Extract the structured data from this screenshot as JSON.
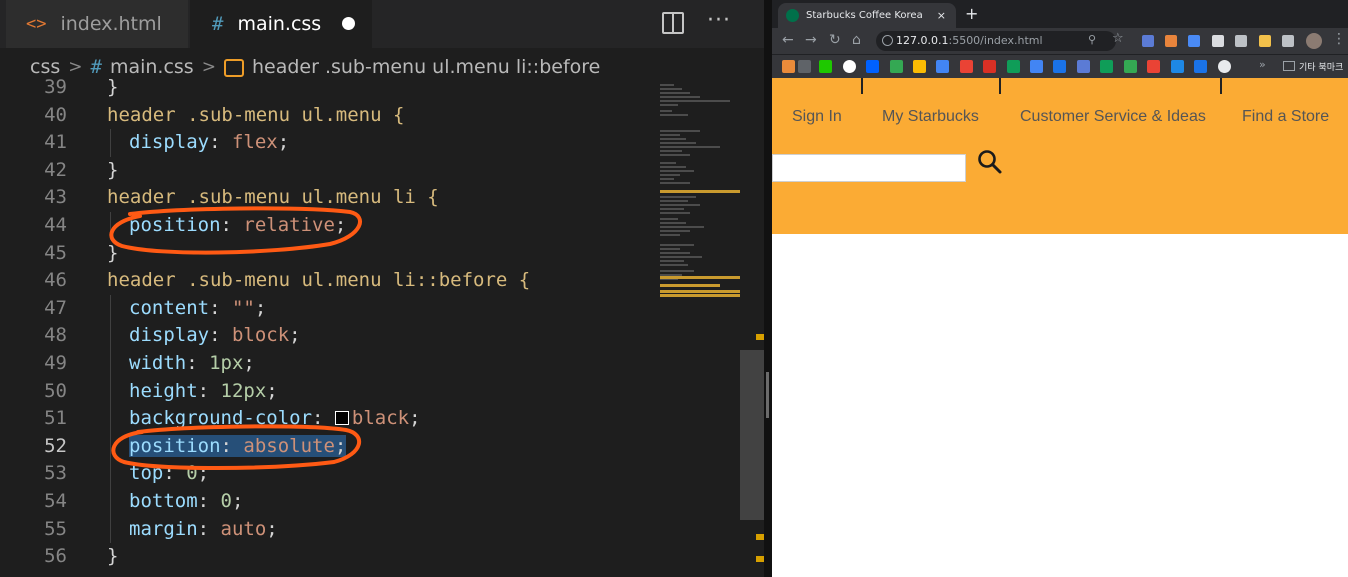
{
  "editor": {
    "tabs": [
      {
        "label": "index.html",
        "icon": "<>"
      },
      {
        "label": "main.css",
        "icon": "#"
      }
    ],
    "breadcrumb": {
      "folder": "css",
      "file": "main.css",
      "symbol": "header .sub-menu ul.menu li::before"
    },
    "lines": [
      {
        "n": "39",
        "text": "}"
      },
      {
        "n": "40",
        "text": "header .sub-menu ul.menu {"
      },
      {
        "n": "41",
        "prop": "display",
        "value": "flex"
      },
      {
        "n": "42",
        "text": "}"
      },
      {
        "n": "43",
        "text": "header .sub-menu ul.menu li {"
      },
      {
        "n": "44",
        "prop": "position",
        "value": "relative"
      },
      {
        "n": "45",
        "text": "}"
      },
      {
        "n": "46",
        "text": "header .sub-menu ul.menu li::before {"
      },
      {
        "n": "47",
        "prop": "content",
        "value": "\"\""
      },
      {
        "n": "48",
        "prop": "display",
        "value": "block"
      },
      {
        "n": "49",
        "prop": "width",
        "value": "1px"
      },
      {
        "n": "50",
        "prop": "height",
        "value": "12px"
      },
      {
        "n": "51",
        "prop": "background-color",
        "value": "black"
      },
      {
        "n": "52",
        "prop": "position",
        "value": "absolute"
      },
      {
        "n": "53",
        "prop": "top",
        "value": "0"
      },
      {
        "n": "54",
        "prop": "bottom",
        "value": "0"
      },
      {
        "n": "55",
        "prop": "margin",
        "value": "auto"
      },
      {
        "n": "56",
        "text": "}"
      }
    ],
    "active_line": "52",
    "annotation_color": "#ff5a14"
  },
  "browser": {
    "tab_title": "Starbucks Coffee Korea",
    "tab_close": "×",
    "new_tab": "+",
    "url_host": "127.0.0.1",
    "url_path": ":5500/index.html",
    "other_bookmarks": "기타 북마크",
    "bookmarks_more": "»",
    "menu": [
      "Sign In",
      "My Starbucks",
      "Customer Service & Ideas",
      "Find a Store"
    ],
    "header_color": "#fbab34"
  }
}
